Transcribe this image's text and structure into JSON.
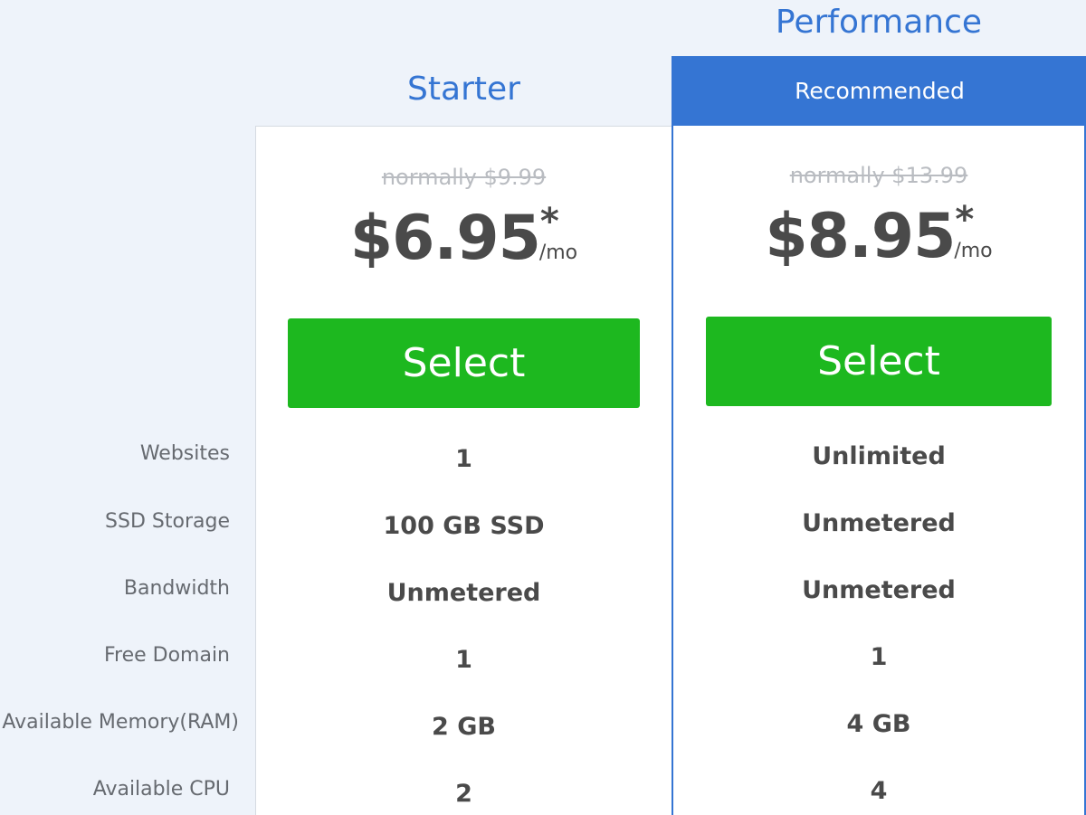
{
  "feature_labels": {
    "websites": "Websites",
    "ssd_storage": "SSD Storage",
    "bandwidth": "Bandwidth",
    "free_domain": "Free Domain",
    "memory": "Available Memory(RAM)",
    "cpu": "Available CPU"
  },
  "plans": [
    {
      "name": "Starter",
      "badge": "",
      "normal_price": "normally $9.99",
      "price": "$6.95",
      "price_star": "*",
      "price_unit": "/mo",
      "select_label": "Select",
      "features": {
        "websites": "1",
        "ssd_storage": "100 GB SSD",
        "bandwidth": "Unmetered",
        "free_domain": "1",
        "memory": "2 GB",
        "cpu": "2"
      }
    },
    {
      "name": "Performance",
      "badge": "Recommended",
      "normal_price": "normally $13.99",
      "price": "$8.95",
      "price_star": "*",
      "price_unit": "/mo",
      "select_label": "Select",
      "features": {
        "websites": "Unlimited",
        "ssd_storage": "Unmetered",
        "bandwidth": "Unmetered",
        "free_domain": "1",
        "memory": "4 GB",
        "cpu": "4"
      }
    }
  ],
  "colors": {
    "background": "#eef3fa",
    "accent_blue": "#3575d3",
    "select_green": "#1db81f",
    "text_dark": "#4a4a4a",
    "text_muted": "#666a70",
    "strikethrough_gray": "#b9bcc1"
  }
}
